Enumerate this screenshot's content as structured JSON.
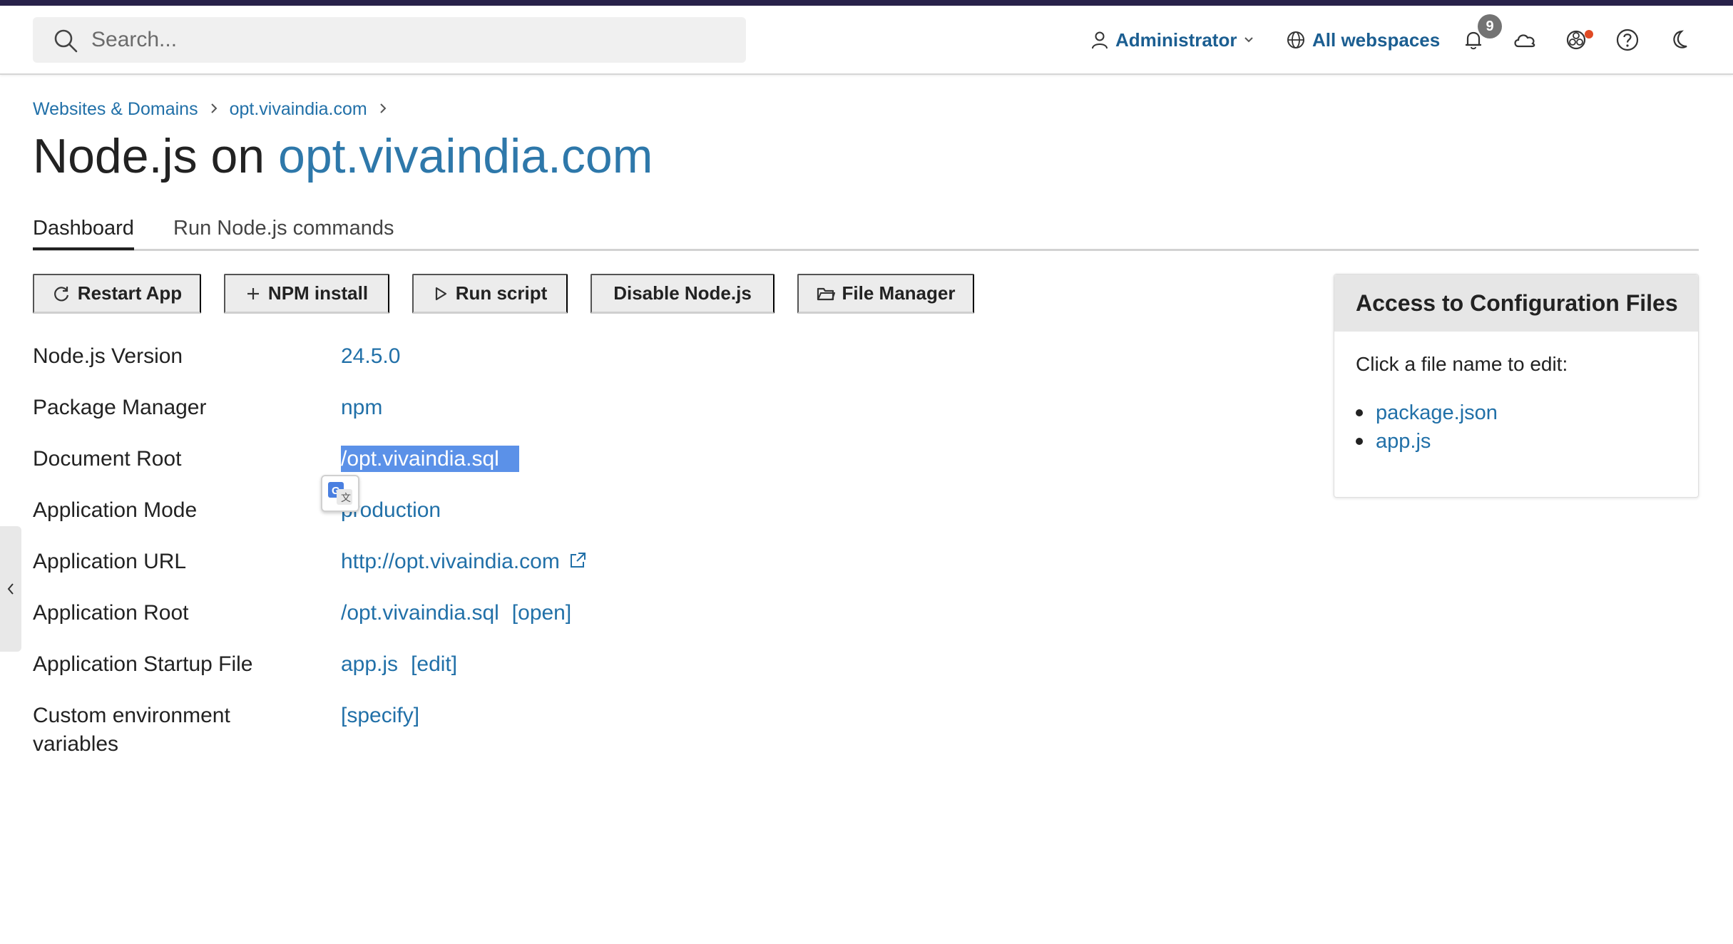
{
  "topbar": {
    "search_placeholder": "Search...",
    "user_label": "Administrator",
    "webspaces_label": "All webspaces",
    "notifications_count": "9"
  },
  "breadcrumb": {
    "items": [
      "Websites & Domains",
      "opt.vivaindia.com"
    ]
  },
  "page": {
    "title_prefix": "Node.js on",
    "title_domain": "opt.vivaindia.com"
  },
  "tabs": [
    "Dashboard",
    "Run Node.js commands"
  ],
  "toolbar": {
    "restart": "Restart App",
    "npm_install": "NPM install",
    "run_script": "Run script",
    "disable": "Disable Node.js",
    "file_manager": "File Manager"
  },
  "info": {
    "node_version_label": "Node.js Version",
    "node_version": "24.5.0",
    "package_manager_label": "Package Manager",
    "package_manager": "npm",
    "document_root_label": "Document Root",
    "document_root": "/opt.vivaindia.sql",
    "app_mode_label": "Application Mode",
    "app_mode": "production",
    "app_url_label": "Application URL",
    "app_url": "http://opt.vivaindia.com",
    "app_root_label": "Application Root",
    "app_root": "/opt.vivaindia.sql",
    "app_root_action": "[open]",
    "startup_file_label": "Application Startup File",
    "startup_file": "app.js",
    "startup_file_action": "[edit]",
    "env_vars_label": "Custom environment variables",
    "env_vars_action": "[specify]"
  },
  "config_panel": {
    "title": "Access to Configuration Files",
    "text": "Click a file name to edit:",
    "files": [
      "package.json",
      "app.js"
    ]
  },
  "colors": {
    "link": "#2170a8",
    "selection": "#5b91e8",
    "topstripe": "#28214a"
  }
}
